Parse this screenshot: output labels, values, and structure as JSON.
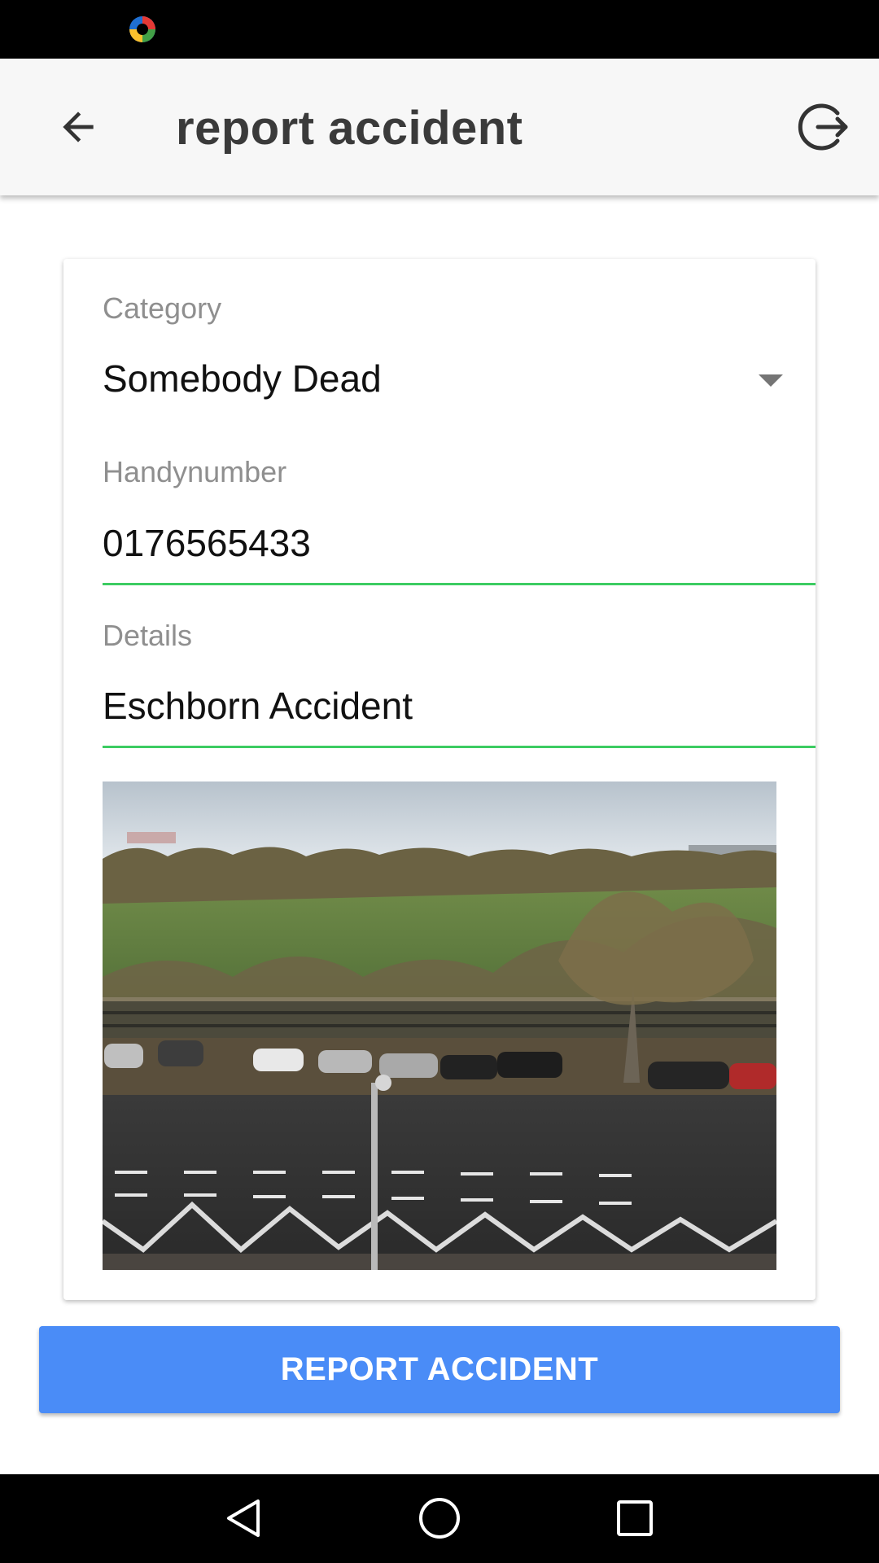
{
  "app_bar": {
    "title": "report accident",
    "back_icon": "arrow-back-icon",
    "logout_icon": "logout-icon"
  },
  "form": {
    "category": {
      "label": "Category",
      "value": "Somebody Dead"
    },
    "handynumber": {
      "label": "Handynumber",
      "value": "0176565433"
    },
    "details": {
      "label": "Details",
      "value": "Eschborn Accident"
    },
    "photo_icon": "attached-photo"
  },
  "report_button": {
    "label": "REPORT ACCIDENT"
  },
  "colors": {
    "accent": "#4a8cf7",
    "underline": "#3ccc62",
    "app_bar_bg": "#f7f7f7"
  },
  "nav": {
    "back": "nav-back-icon",
    "home": "nav-home-icon",
    "recents": "nav-recents-icon"
  }
}
